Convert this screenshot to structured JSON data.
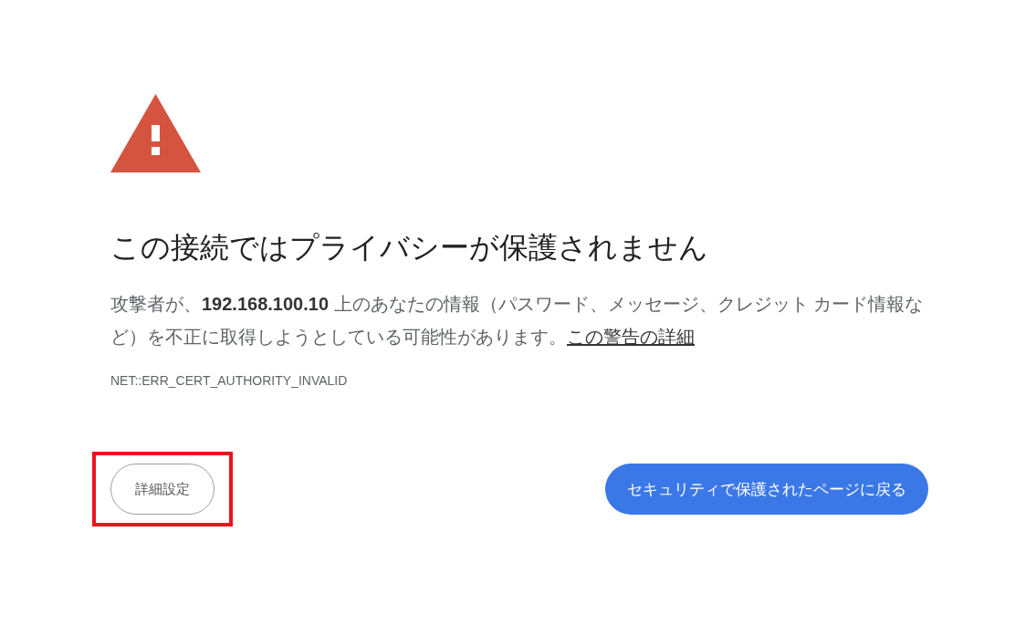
{
  "heading": "この接続ではプライバシーが保護されません",
  "paragraph": {
    "text": "攻撃者が、**192.168.100.10** 上のあなたの情報（パスワード、メッセージ、クレジット カード情報など）を不正に取得しようとしている可能性があります。",
    "link": "この警告の詳細"
  },
  "error_code": "NET::ERR_CERT_AUTHORITY_INVALID",
  "buttons": [
    {
      "kind": "secondary",
      "label": "詳細設定",
      "highlighted": true
    },
    {
      "kind": "primary",
      "label": "セキュリティで保護されたページに戻る",
      "highlighted": false
    }
  ]
}
